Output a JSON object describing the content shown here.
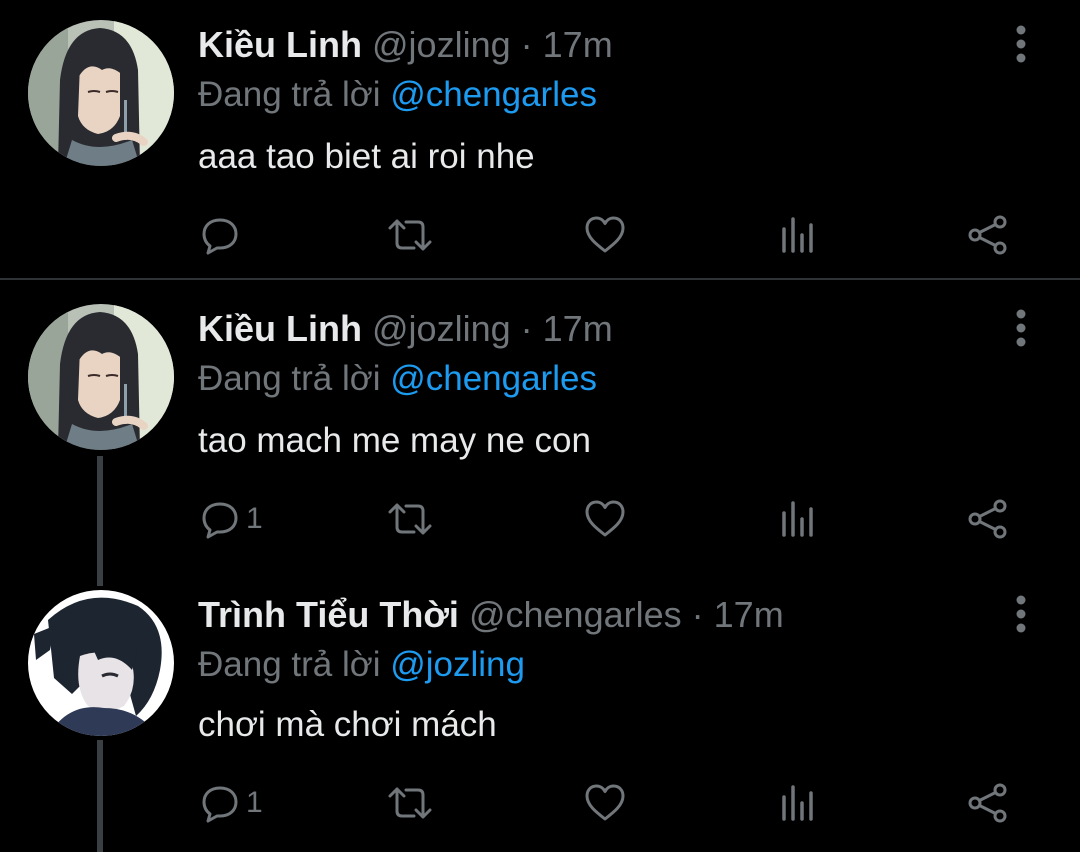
{
  "tweets": [
    {
      "name": "Kiều Linh",
      "handle": "@jozling",
      "separator": "·",
      "time": "17m",
      "reply_prefix": "Đang trả lời ",
      "reply_to": "@chengarles",
      "text": "aaa tao biet ai roi nhe",
      "reply_count": ""
    },
    {
      "name": "Kiều Linh",
      "handle": "@jozling",
      "separator": "·",
      "time": "17m",
      "reply_prefix": "Đang trả lời ",
      "reply_to": "@chengarles",
      "text": "tao mach me may ne con",
      "reply_count": "1"
    },
    {
      "name": "Trình Tiểu Thời",
      "handle": "@chengarles",
      "separator": "·",
      "time": "17m",
      "reply_prefix": "Đang trả lời ",
      "reply_to": "@jozling",
      "text": "chơi mà chơi mách",
      "reply_count": "1"
    }
  ],
  "icons": {
    "reply": "reply-icon",
    "retweet": "retweet-icon",
    "like": "heart-icon",
    "analytics": "analytics-icon",
    "share": "share-icon",
    "more": "more-vertical-icon"
  },
  "colors": {
    "background": "#000000",
    "text": "#e7e9ea",
    "secondary": "#71767b",
    "mention": "#1d9bf0",
    "divider": "#2f3336"
  }
}
